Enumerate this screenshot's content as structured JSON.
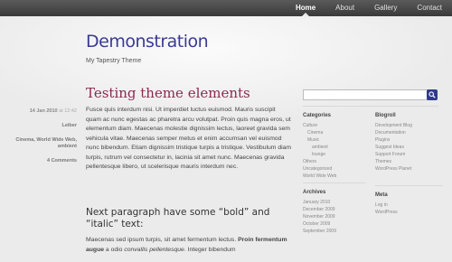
{
  "nav": {
    "items": [
      "Home",
      "About",
      "Gallery",
      "Contact"
    ]
  },
  "site": {
    "title": "Demonstration",
    "tagline": "My Tapestry Theme"
  },
  "meta": {
    "date": "14 Jan 2010",
    "time": "at 12:42",
    "author": "Leiber",
    "categories": "Cinema, World Wide Web, ambient",
    "comments": "4 Comments"
  },
  "post": {
    "title": "Testing theme elements",
    "para1": "Fusce quis interdum nisi. Ut imperdiet luctus euismod. Mauris suscipit quam ac nunc egestas ac pharetra arcu volutpat. Proin quis magna eros, ut elementum diam. Maecenas molestie dignissim lectus, laoreet gravida sem vehicula vitae. Maecenas semper metus et enim accumsan vel euismod nunc bibendum. Etiam dignissim tristique turpis a tristique. Vestibulum diam turpis, rutrum vel consectetur in, lacinia sit amet nunc. Maecenas gravida pellentesque libero, ut scelerisque mauris interdum nec.",
    "subhead": "Next paragraph have some “bold” and “italic” text:",
    "para2_a": "Maecenas sed ipsum turpis, sit amet fermentum lectus. ",
    "para2_bold": "Proin fermentum augue",
    "para2_b": " a odio ",
    "para2_italic": "convallis pellentesque",
    "para2_c": ". Integer bibendum"
  },
  "sidebar": {
    "categories": {
      "title": "Categories",
      "items": [
        "Culture",
        "Cinema",
        "Music",
        "ambient",
        "lounge",
        "Others",
        "Uncategorized",
        "World Wide Web"
      ]
    },
    "archives": {
      "title": "Archives",
      "items": [
        "January 2010",
        "December 2009",
        "November 2009",
        "October 2009",
        "September 2009"
      ]
    },
    "blogroll": {
      "title": "Blogroll",
      "items": [
        "Development Blog",
        "Documentation",
        "Plugins",
        "Suggest Ideas",
        "Support Forum",
        "Themes",
        "WordPress Planet"
      ]
    },
    "metabox": {
      "title": "Meta",
      "items": [
        "Log in",
        "WordPress"
      ]
    }
  },
  "colors": {
    "accent_title": "#3a3a96",
    "post_title": "#8a2a4e",
    "search_button": "#2f3c8a",
    "topbar": "#4a4a4a"
  },
  "icons": {
    "search": "search-icon"
  }
}
